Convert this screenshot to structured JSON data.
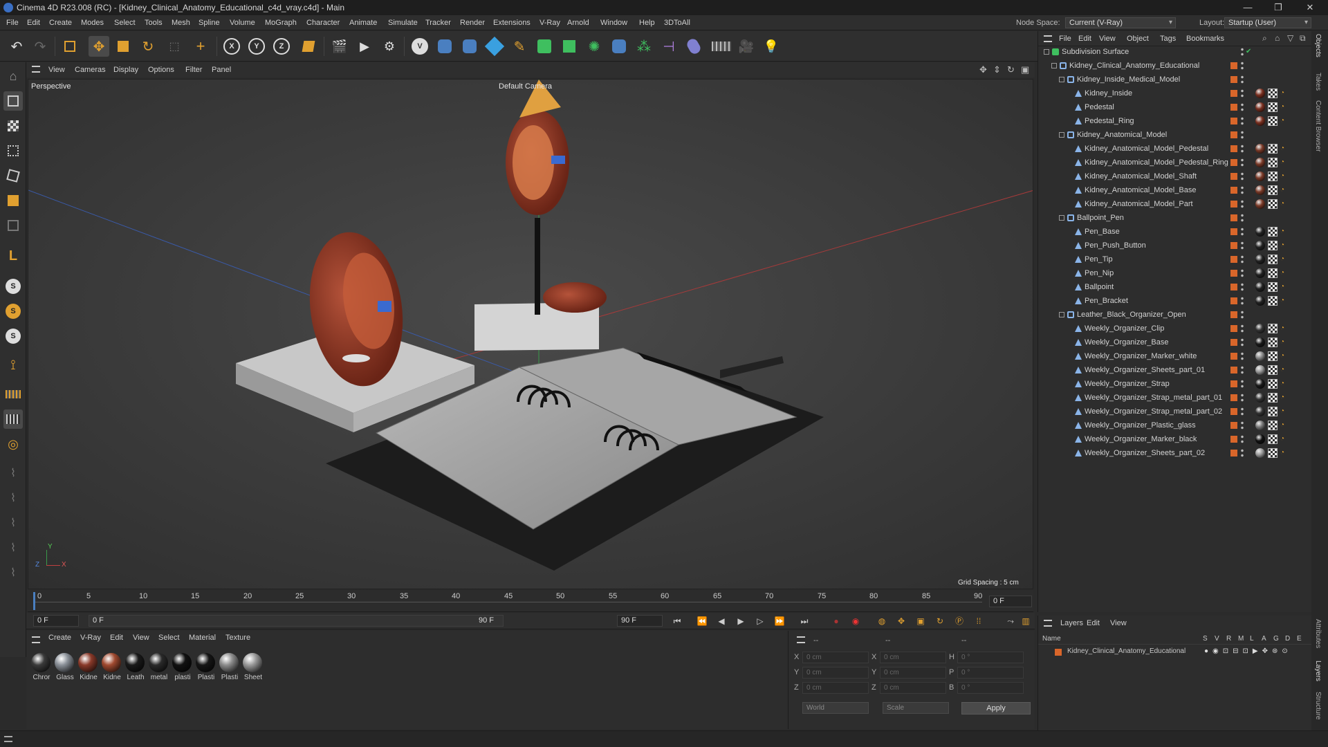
{
  "window": {
    "title": "Cinema 4D R23.008 (RC) - [Kidney_Clinical_Anatomy_Educational_c4d_vray.c4d] - Main"
  },
  "menu": [
    "File",
    "Edit",
    "Create",
    "Modes",
    "Select",
    "Tools",
    "Mesh",
    "Spline",
    "Volume",
    "MoGraph",
    "Character",
    "Animate",
    "Simulate",
    "Tracker",
    "Render",
    "Extensions",
    "V-Ray",
    "Arnold",
    "Window",
    "Help",
    "3DToAll"
  ],
  "node_space": {
    "label": "Node Space:",
    "value": "Current (V-Ray)"
  },
  "layout": {
    "label": "Layout:",
    "value": "Startup (User)"
  },
  "viewport": {
    "menu": [
      "View",
      "Cameras",
      "Display",
      "Options",
      "Filter",
      "Panel"
    ],
    "label": "Perspective",
    "camera": "Default Camera",
    "grid_spacing": "Grid Spacing : 5 cm",
    "axis": {
      "x": "X",
      "y": "Y",
      "z": "Z"
    }
  },
  "timeline": {
    "ticks": [
      "0",
      "5",
      "10",
      "15",
      "20",
      "25",
      "30",
      "35",
      "40",
      "45",
      "50",
      "55",
      "60",
      "65",
      "70",
      "75",
      "80",
      "85",
      "90"
    ],
    "current_frame": "0 F"
  },
  "transport": {
    "start": "0 F",
    "current": "0 F",
    "end_field": "90 F",
    "end": "90 F"
  },
  "material_manager": {
    "menu": [
      "Create",
      "V-Ray",
      "Edit",
      "View",
      "Select",
      "Material",
      "Texture"
    ],
    "materials": [
      {
        "name": "Chror",
        "color": "#3a3a3a"
      },
      {
        "name": "Glass",
        "color": "#8a9098"
      },
      {
        "name": "Kidne",
        "color": "#8a3a2a"
      },
      {
        "name": "Kidne",
        "color": "#a04a30"
      },
      {
        "name": "Leath",
        "color": "#1a1a1a"
      },
      {
        "name": "metal",
        "color": "#2a2a2a"
      },
      {
        "name": "plasti",
        "color": "#111111"
      },
      {
        "name": "Plasti",
        "color": "#161616"
      },
      {
        "name": "Plasti",
        "color": "#8c8c8c"
      },
      {
        "name": "Sheet",
        "color": "#9a9a9a"
      }
    ]
  },
  "coordinates": {
    "header": [
      "--",
      "--",
      "--"
    ],
    "rows": [
      {
        "a": "X",
        "av": "0 cm",
        "b": "X",
        "bv": "0 cm",
        "c": "H",
        "cv": "0 °"
      },
      {
        "a": "Y",
        "av": "0 cm",
        "b": "Y",
        "bv": "0 cm",
        "c": "P",
        "cv": "0 °"
      },
      {
        "a": "Z",
        "av": "0 cm",
        "b": "Z",
        "bv": "0 cm",
        "c": "B",
        "cv": "0 °"
      }
    ],
    "mode": "World",
    "size_mode": "Scale",
    "apply": "Apply"
  },
  "object_manager": {
    "menu": [
      "File",
      "Edit",
      "View",
      "Object",
      "Tags",
      "Bookmarks"
    ],
    "objects": [
      {
        "name": "Subdivision Surface",
        "level": 0,
        "type": "subdiv",
        "tags": false
      },
      {
        "name": "Kidney_Clinical_Anatomy_Educational",
        "level": 1,
        "type": "null",
        "tags": false
      },
      {
        "name": "Kidney_Inside_Medical_Model",
        "level": 2,
        "type": "null",
        "tags": false
      },
      {
        "name": "Kidney_Inside",
        "level": 3,
        "type": "poly",
        "tags": true,
        "tag_color": "#7a3020"
      },
      {
        "name": "Pedestal",
        "level": 3,
        "type": "poly",
        "tags": true,
        "tag_color": "#7a3020"
      },
      {
        "name": "Pedestal_Ring",
        "level": 3,
        "type": "poly",
        "tags": true,
        "tag_color": "#7a3020"
      },
      {
        "name": "Kidney_Anatomical_Model",
        "level": 2,
        "type": "null",
        "tags": false
      },
      {
        "name": "Kidney_Anatomical_Model_Pedestal",
        "level": 3,
        "type": "poly",
        "tags": true,
        "tag_color": "#7a3a28"
      },
      {
        "name": "Kidney_Anatomical_Model_Pedestal_Ring",
        "level": 3,
        "type": "poly",
        "tags": true,
        "tag_color": "#7a3a28"
      },
      {
        "name": "Kidney_Anatomical_Model_Shaft",
        "level": 3,
        "type": "poly",
        "tags": true,
        "tag_color": "#7a3a28"
      },
      {
        "name": "Kidney_Anatomical_Model_Base",
        "level": 3,
        "type": "poly",
        "tags": true,
        "tag_color": "#7a3a28"
      },
      {
        "name": "Kidney_Anatomical_Model_Part",
        "level": 3,
        "type": "poly",
        "tags": true,
        "tag_color": "#7a3a28"
      },
      {
        "name": "Ballpoint_Pen",
        "level": 2,
        "type": "null",
        "tags": false
      },
      {
        "name": "Pen_Base",
        "level": 3,
        "type": "poly",
        "tags": true,
        "tag_color": "#222222"
      },
      {
        "name": "Pen_Push_Button",
        "level": 3,
        "type": "poly",
        "tags": true,
        "tag_color": "#222222"
      },
      {
        "name": "Pen_Tip",
        "level": 3,
        "type": "poly",
        "tags": true,
        "tag_color": "#222222"
      },
      {
        "name": "Pen_Nip",
        "level": 3,
        "type": "poly",
        "tags": true,
        "tag_color": "#222222"
      },
      {
        "name": "Ballpoint",
        "level": 3,
        "type": "poly",
        "tags": true,
        "tag_color": "#222222"
      },
      {
        "name": "Pen_Bracket",
        "level": 3,
        "type": "poly",
        "tags": true,
        "tag_color": "#222222"
      },
      {
        "name": "Leather_Black_Organizer_Open",
        "level": 2,
        "type": "null",
        "tags": false
      },
      {
        "name": "Weekly_Organizer_Clip",
        "level": 3,
        "type": "poly",
        "tags": true,
        "tag_color": "#333333"
      },
      {
        "name": "Weekly_Organizer_Base",
        "level": 3,
        "type": "poly",
        "tags": true,
        "tag_color": "#1a1a1a"
      },
      {
        "name": "Weekly_Organizer_Marker_white",
        "level": 3,
        "type": "poly",
        "tags": true,
        "tag_color": "#888888"
      },
      {
        "name": "Weekly_Organizer_Sheets_part_01",
        "level": 3,
        "type": "poly",
        "tags": true,
        "tag_color": "#999999"
      },
      {
        "name": "Weekly_Organizer_Strap",
        "level": 3,
        "type": "poly",
        "tags": true,
        "tag_color": "#1a1a1a"
      },
      {
        "name": "Weekly_Organizer_Strap_metal_part_01",
        "level": 3,
        "type": "poly",
        "tags": true,
        "tag_color": "#333333"
      },
      {
        "name": "Weekly_Organizer_Strap_metal_part_02",
        "level": 3,
        "type": "poly",
        "tags": true,
        "tag_color": "#333333"
      },
      {
        "name": "Weekly_Organizer_Plastic_glass",
        "level": 3,
        "type": "poly",
        "tags": true,
        "tag_color": "#777777"
      },
      {
        "name": "Weekly_Organizer_Marker_black",
        "level": 3,
        "type": "poly",
        "tags": true,
        "tag_color": "#111111"
      },
      {
        "name": "Weekly_Organizer_Sheets_part_02",
        "level": 3,
        "type": "poly",
        "tags": true,
        "tag_color": "#999999"
      }
    ]
  },
  "layer_manager": {
    "menu": [
      "Layers",
      "Edit",
      "View"
    ],
    "col_name": "Name",
    "cols": [
      "S",
      "V",
      "R",
      "M",
      "L",
      "A",
      "G",
      "D",
      "E"
    ],
    "layers": [
      {
        "name": "Kidney_Clinical_Anatomy_Educational",
        "color": "#d9662a"
      }
    ]
  },
  "side_tabs": [
    "Objects",
    "Takes",
    "Content Browser",
    "Attributes",
    "Layers",
    "Structure"
  ],
  "colors": {
    "accent": "#d9662a",
    "selection": "#4a7fc0"
  }
}
